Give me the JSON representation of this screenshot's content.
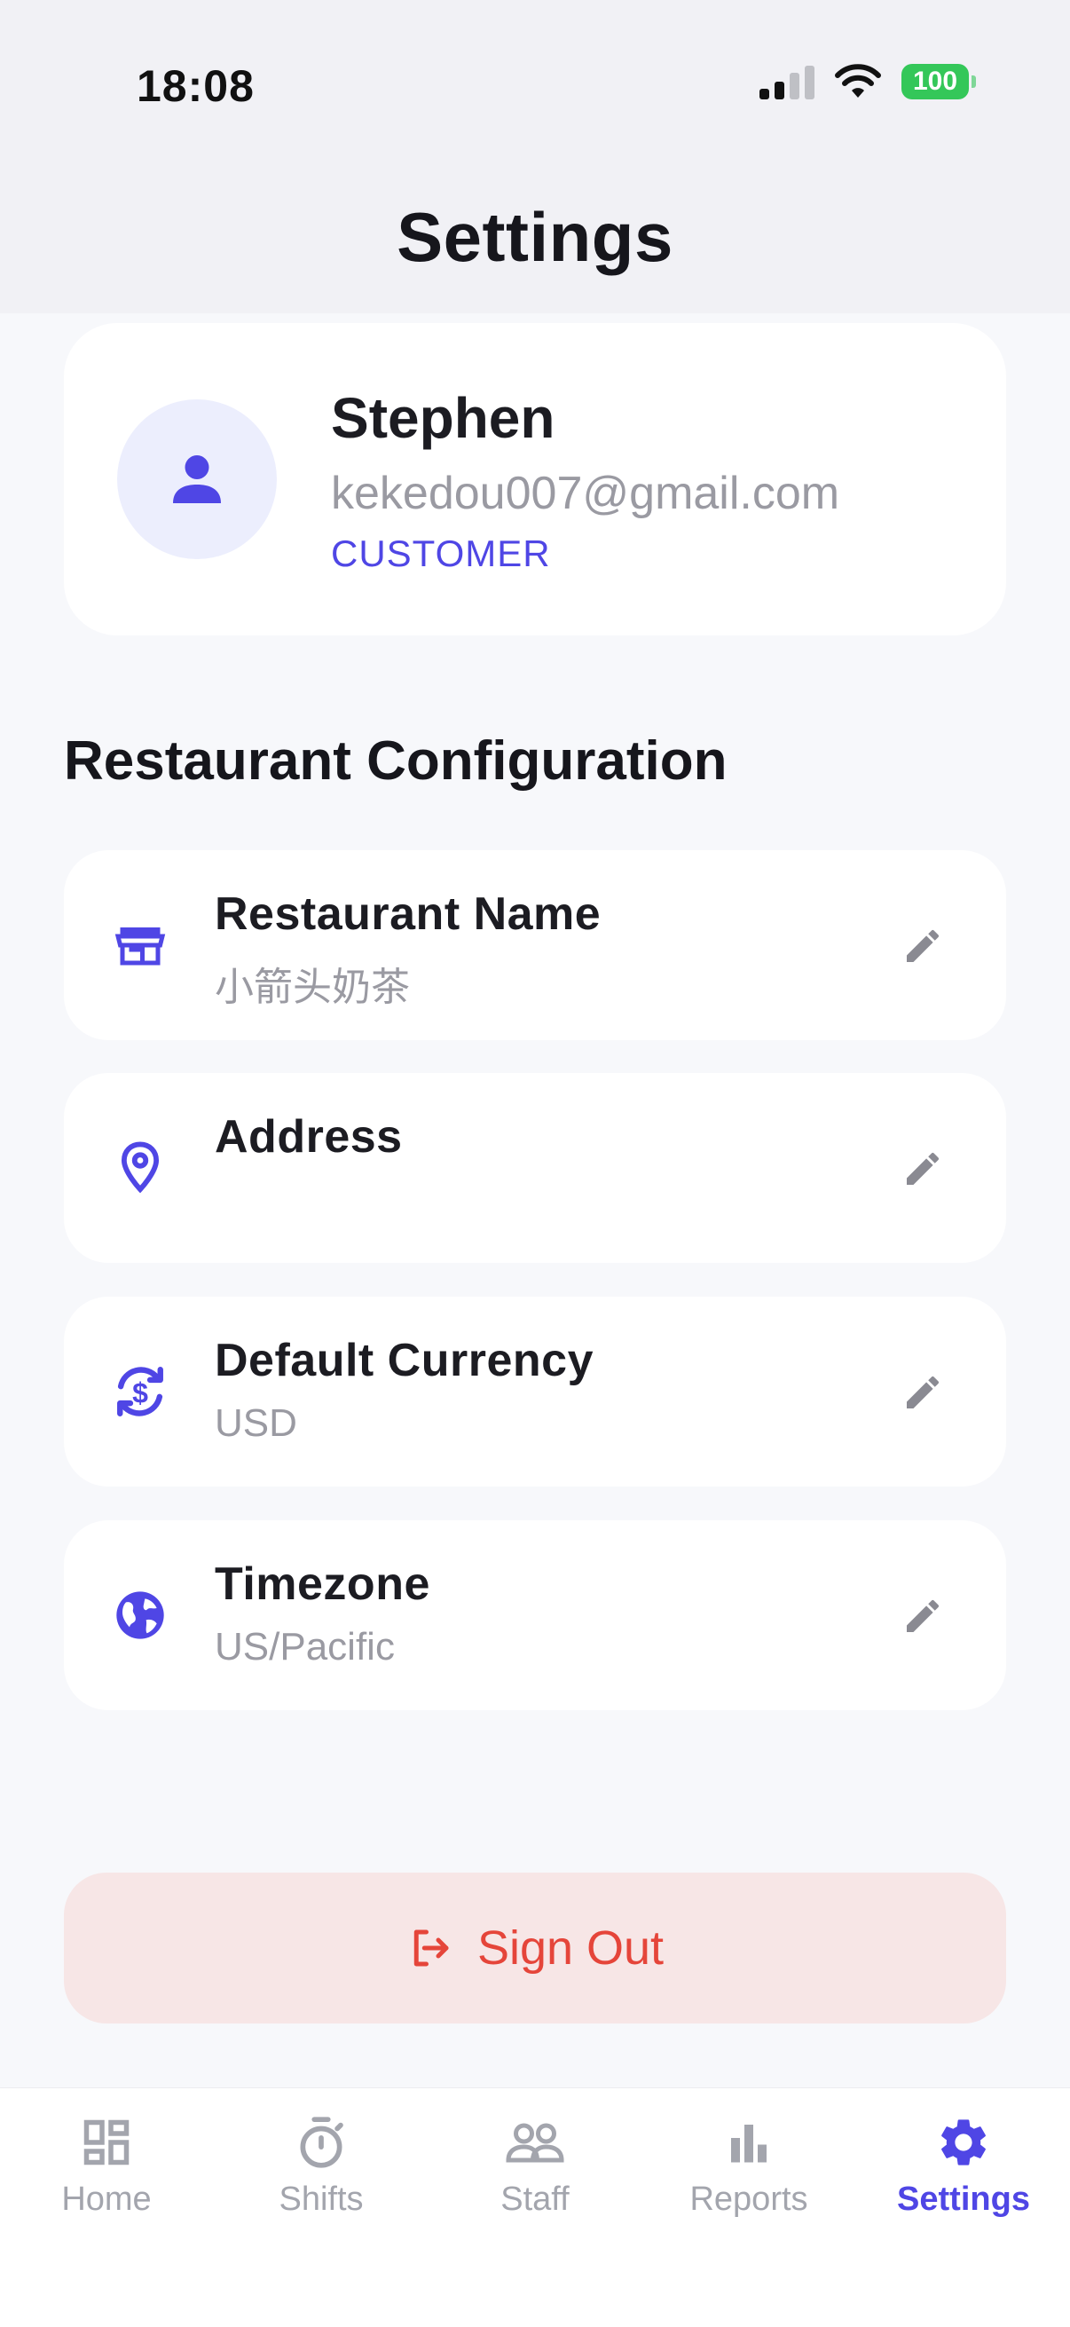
{
  "status_bar": {
    "time": "18:08",
    "battery": "100"
  },
  "header": {
    "title": "Settings"
  },
  "profile": {
    "name": "Stephen",
    "email": "kekedou007@gmail.com",
    "role": "CUSTOMER"
  },
  "config": {
    "section_title": "Restaurant Configuration",
    "items": [
      {
        "label": "Restaurant Name",
        "value": "小箭头奶茶",
        "icon": "store-icon"
      },
      {
        "label": "Address",
        "value": "",
        "icon": "location-pin-icon"
      },
      {
        "label": "Default Currency",
        "value": "USD",
        "icon": "currency-exchange-icon"
      },
      {
        "label": "Timezone",
        "value": "US/Pacific",
        "icon": "globe-icon"
      }
    ]
  },
  "actions": {
    "sign_out": "Sign Out"
  },
  "tabs": [
    {
      "label": "Home",
      "icon": "dashboard-icon"
    },
    {
      "label": "Shifts",
      "icon": "stopwatch-icon"
    },
    {
      "label": "Staff",
      "icon": "people-icon"
    },
    {
      "label": "Reports",
      "icon": "bar-chart-icon"
    },
    {
      "label": "Settings",
      "icon": "gear-icon",
      "active": true
    }
  ],
  "colors": {
    "accent": "#4f46e5",
    "danger": "#e5453a",
    "danger_bg": "#f7e6e6",
    "muted": "#9a9aa2"
  }
}
